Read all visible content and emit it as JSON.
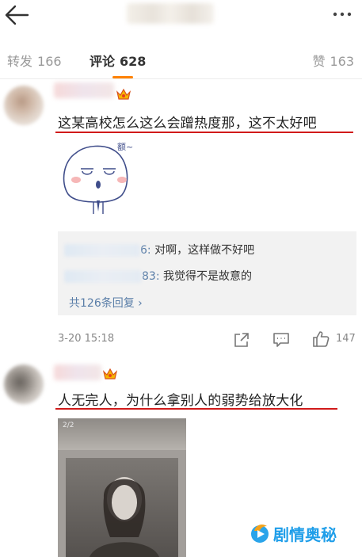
{
  "tabs": {
    "forward": {
      "label": "转发",
      "count": "166"
    },
    "comments": {
      "label": "评论",
      "count": "628"
    },
    "likes": {
      "label": "赞",
      "count": "163"
    }
  },
  "comments": [
    {
      "text": "这某高校怎么这么会蹭热度那，这不太好吧",
      "sticker_caption": "额~",
      "replies": [
        {
          "suffix": "6:",
          "text": " 对啊，这样做不好吧"
        },
        {
          "suffix": "83:",
          "text": " 我觉得不是故意的"
        }
      ],
      "more_replies": "共126条回复 ›",
      "time": "3-20 15:18",
      "like_count": "147"
    },
    {
      "text": "人无完人，为什么拿别人的弱势给放大化",
      "photo_page": "2/2"
    }
  ],
  "watermark": {
    "text": "剧情奥秘"
  },
  "colors": {
    "accent": "#ff8200",
    "highlight_line": "#d11a1a",
    "link": "#5a7ea8",
    "watermark": "#1f9ee9"
  }
}
